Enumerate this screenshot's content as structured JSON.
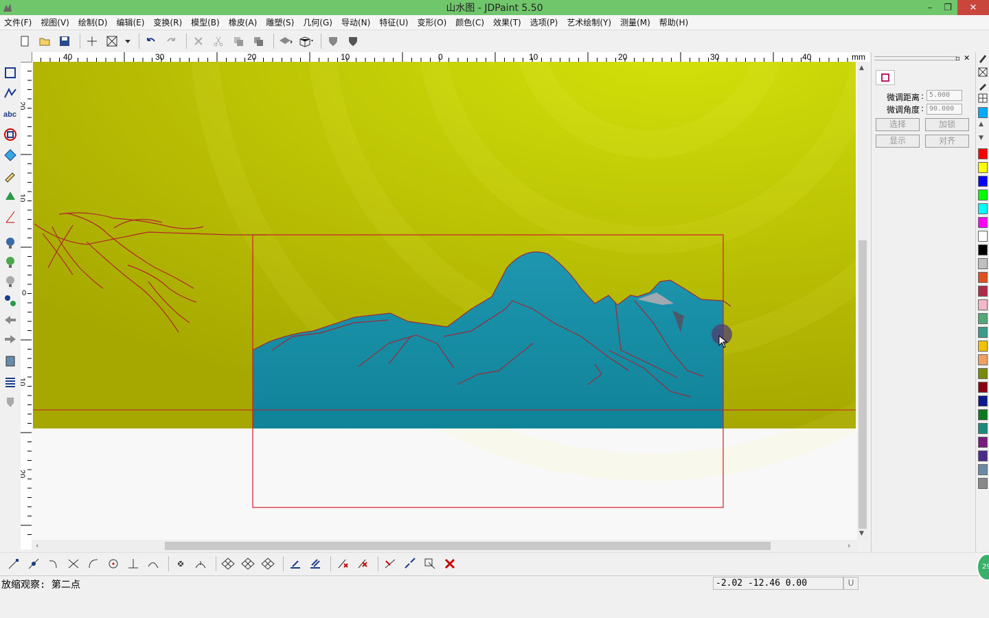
{
  "window": {
    "title": "山水图 - JDPaint 5.50"
  },
  "menu": [
    "文件(F)",
    "视图(V)",
    "绘制(D)",
    "编辑(E)",
    "变换(R)",
    "模型(B)",
    "橡皮(A)",
    "雕塑(S)",
    "几何(G)",
    "导动(N)",
    "特征(U)",
    "变形(O)",
    "颜色(C)",
    "效果(T)",
    "选项(P)",
    "艺术绘制(Y)",
    "测量(M)",
    "帮助(H)"
  ],
  "toolbar": [
    "new-file-icon",
    "open-folder-icon",
    "save-icon",
    "crosshair-icon",
    "select-box-icon",
    "dropdown-arrow-icon",
    "undo-icon",
    "redo-icon",
    "delete-icon",
    "cut-icon",
    "copy-icon",
    "paste-icon",
    "group-icon",
    "cube-view-icon",
    "shield-icon",
    "shield-dark-icon"
  ],
  "ruler": {
    "unit": "mm",
    "h_labels": [
      "40",
      "30",
      "20",
      "10",
      "0",
      "10",
      "20",
      "30",
      "40"
    ],
    "v_labels": [
      "20",
      "10",
      "0",
      "10",
      "20"
    ]
  },
  "right_panel": {
    "dist_label": "微调距离",
    "dist_value": "5.000",
    "angle_label": "微调角度",
    "angle_value": "90.000",
    "btn_select": "选择",
    "btn_lock": "加锁",
    "btn_show": "显示",
    "btn_align": "对齐"
  },
  "palette": [
    "#ff0000",
    "#ffff00",
    "#0000ff",
    "#00ff00",
    "#00ffff",
    "#ff00ff",
    "#ffffff",
    "#000000",
    "#c0c0c0",
    "#e0501e",
    "#b02a4a",
    "#f3b8c8",
    "#52a878",
    "#3a9a88",
    "#f2c200",
    "#f0a060",
    "#7a8a00",
    "#8a0010",
    "#0a1a8a",
    "#0a7a1a",
    "#1a8a7a",
    "#7a1a7a",
    "#4a2a8a",
    "#6a8aaa",
    "#8a8a8a"
  ],
  "status": {
    "message": "放缩观察: 第二点",
    "coords": "-2.02 -12.46 0.00",
    "unit_flag": "U"
  },
  "badge": "29"
}
